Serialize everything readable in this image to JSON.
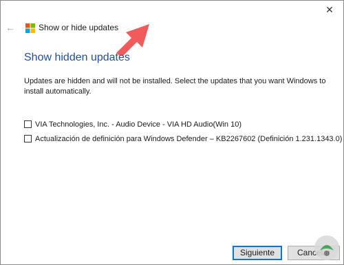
{
  "window": {
    "close_glyph": "✕"
  },
  "header": {
    "back_glyph": "←",
    "app_title": "Show or hide updates"
  },
  "content": {
    "heading": "Show hidden updates",
    "description": "Updates are hidden and will not be installed. Select the updates that you want Windows to install automatically.",
    "updates": [
      {
        "label": "VIA Technologies, Inc. - Audio Device - VIA HD Audio(Win 10)",
        "checked": false
      },
      {
        "label": "Actualización de definición para Windows Defender – KB2267602 (Definición 1.231.1343.0)",
        "checked": false
      }
    ]
  },
  "footer": {
    "next_label": "Siguiente",
    "cancel_label": "Cancelar"
  },
  "colors": {
    "heading": "#1f4e9c",
    "primary_border": "#0078d7",
    "arrow": "#f25b5b",
    "logo_red": "#f25022",
    "logo_green": "#7fba00",
    "logo_blue": "#00a4ef",
    "logo_yellow": "#ffb900"
  },
  "icons": {
    "back": "back-arrow-icon",
    "close": "close-icon",
    "logo": "windows-logo-icon",
    "annotation": "pointer-arrow-icon",
    "watermark": "watermark-logo-icon"
  }
}
